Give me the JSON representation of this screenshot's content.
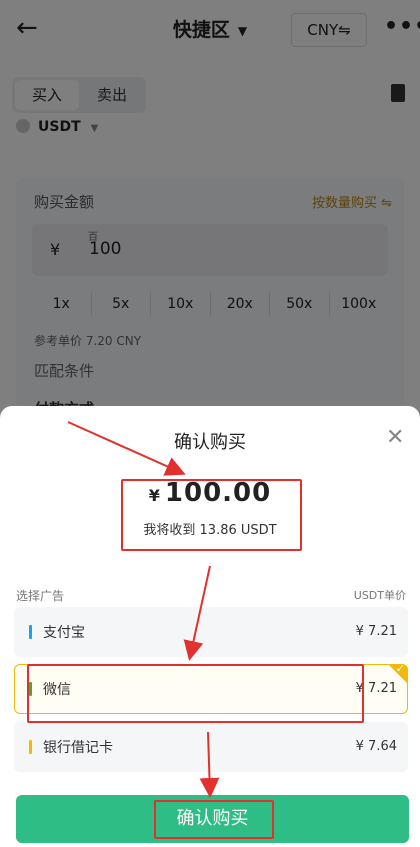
{
  "header": {
    "back_icon": "arrow-left-icon",
    "title": "快捷区",
    "currency_toggle": "CNY⇋",
    "more_icon": "more-horizontal-icon"
  },
  "trade_tabs": [
    {
      "label": "买入",
      "active": true
    },
    {
      "label": "卖出",
      "active": false
    }
  ],
  "coin": {
    "name": "USDT"
  },
  "buy_form": {
    "amount_label": "购买金额",
    "switch_mode": "按数量购买 ⇋",
    "currency_symbol": "¥",
    "unit_hint": "百",
    "amount_value": "100",
    "multipliers": [
      "1x",
      "5x",
      "10x",
      "20x",
      "50x",
      "100x"
    ],
    "ref_price": "参考单价 7.20 CNY",
    "match_label": "匹配条件",
    "partial_peek": "付款方式"
  },
  "sheet": {
    "title": "确认购买",
    "close_icon": "close-icon",
    "currency_symbol": "¥",
    "amount": "100.00",
    "receive_text": "我将收到 13.86 USDT",
    "select_label": "选择广告",
    "unit_label": "USDT单价",
    "options": [
      {
        "name": "支付宝",
        "price": "¥ 7.21",
        "bar_color": "#1e9fe8",
        "selected": false
      },
      {
        "name": "微信",
        "price": "¥ 7.21",
        "bar_color": "#3dae3a",
        "selected": true
      },
      {
        "name": "银行借记卡",
        "price": "¥ 7.64",
        "bar_color": "#f0b90b",
        "selected": false
      }
    ],
    "confirm_label": "确认购买"
  },
  "colors": {
    "accent_green": "#2dbd85",
    "highlight_yellow": "#f0b90b",
    "annotation_red": "#e0312f"
  }
}
